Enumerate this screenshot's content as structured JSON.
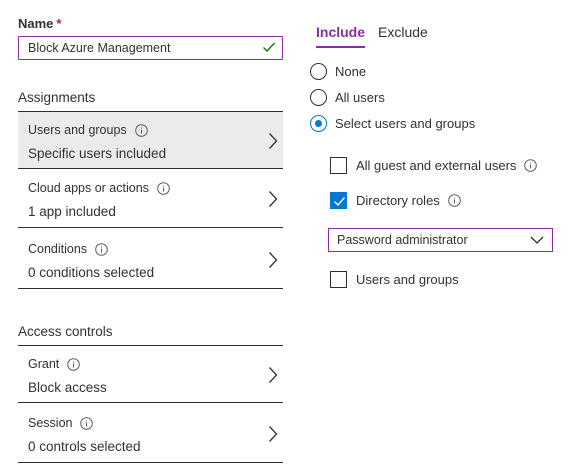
{
  "name": {
    "label": "Name",
    "required_marker": "*",
    "value": "Block Azure Management"
  },
  "assignments": {
    "title": "Assignments",
    "items": [
      {
        "title": "Users and groups",
        "subtitle": "Specific users included",
        "selected": true
      },
      {
        "title": "Cloud apps or actions",
        "subtitle": "1 app included",
        "selected": false
      },
      {
        "title": "Conditions",
        "subtitle": "0 conditions selected",
        "selected": false
      }
    ]
  },
  "access_controls": {
    "title": "Access controls",
    "items": [
      {
        "title": "Grant",
        "subtitle": "Block access"
      },
      {
        "title": "Session",
        "subtitle": "0 controls selected"
      }
    ]
  },
  "tabs": [
    {
      "label": "Include",
      "active": true
    },
    {
      "label": "Exclude",
      "active": false
    }
  ],
  "radio_options": [
    {
      "label": "None",
      "checked": false
    },
    {
      "label": "All users",
      "checked": false
    },
    {
      "label": "Select users and groups",
      "checked": true
    }
  ],
  "checkboxes": [
    {
      "label": "All guest and external users",
      "checked": false,
      "info": true
    },
    {
      "label": "Directory roles",
      "checked": true,
      "info": true
    },
    {
      "label": "Users and groups",
      "checked": false,
      "info": false
    }
  ],
  "directory_roles_dropdown": {
    "selected": "Password administrator"
  },
  "colors": {
    "accent": "#8a2da5",
    "primary_blue": "#0078d4",
    "selected_row_bg": "#edebe9",
    "valid_check": "#107c10"
  }
}
